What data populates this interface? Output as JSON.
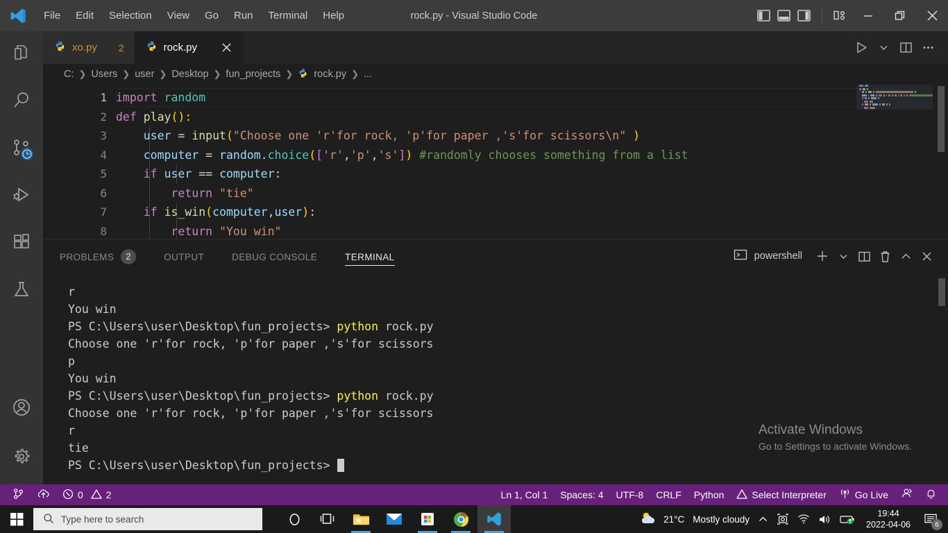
{
  "titlebar": {
    "menu": [
      "File",
      "Edit",
      "Selection",
      "View",
      "Go",
      "Run",
      "Terminal",
      "Help"
    ],
    "title": "rock.py - Visual Studio Code",
    "layout_controls": [
      "toggle-primary-sidebar",
      "toggle-panel",
      "toggle-secondary-sidebar",
      "customize-layout"
    ],
    "window_controls": [
      "minimize",
      "restore",
      "close"
    ]
  },
  "activitybar": {
    "items": [
      {
        "name": "explorer",
        "icon": "files-icon"
      },
      {
        "name": "search",
        "icon": "search-icon"
      },
      {
        "name": "source-control",
        "icon": "source-control-icon",
        "badge": "clock"
      },
      {
        "name": "run-and-debug",
        "icon": "debug-icon"
      },
      {
        "name": "extensions",
        "icon": "extensions-icon"
      },
      {
        "name": "testing",
        "icon": "beaker-icon"
      },
      {
        "name": "accounts",
        "icon": "account-icon"
      },
      {
        "name": "manage",
        "icon": "gear-icon"
      }
    ]
  },
  "tabs": [
    {
      "label": "xo.py",
      "icon": "python-icon",
      "badge": "2",
      "active": false,
      "dirty": true
    },
    {
      "label": "rock.py",
      "icon": "python-icon",
      "badge": "",
      "active": true,
      "dirty": false
    }
  ],
  "tab_actions": [
    "run-python-file",
    "run-dropdown",
    "split-editor",
    "more-actions"
  ],
  "breadcrumb": [
    "C:",
    "Users",
    "user",
    "Desktop",
    "fun_projects",
    "rock.py",
    "..."
  ],
  "breadcrumb_file_icon": "python-icon",
  "editor": {
    "language": "Python",
    "lines": [
      {
        "n": "1",
        "tokens": [
          {
            "t": "import ",
            "c": "k"
          },
          {
            "t": "random",
            "c": "mod"
          }
        ]
      },
      {
        "n": "2",
        "tokens": [
          {
            "t": "def ",
            "c": "k"
          },
          {
            "t": "play",
            "c": "fn"
          },
          {
            "t": "():",
            "c": "p1"
          }
        ]
      },
      {
        "n": "3",
        "tokens": [
          {
            "t": "    ",
            "c": "op"
          },
          {
            "t": "user",
            "c": "var"
          },
          {
            "t": " = ",
            "c": "op"
          },
          {
            "t": "input",
            "c": "fn"
          },
          {
            "t": "(",
            "c": "p1"
          },
          {
            "t": "\"Choose one 'r'for rock, 'p'for paper ,'s'for scissors\\n\"",
            "c": "str"
          },
          {
            "t": " )",
            "c": "p1"
          }
        ]
      },
      {
        "n": "4",
        "tokens": [
          {
            "t": "    ",
            "c": "op"
          },
          {
            "t": "computer",
            "c": "var"
          },
          {
            "t": " = ",
            "c": "op"
          },
          {
            "t": "random",
            "c": "var"
          },
          {
            "t": ".",
            "c": "op"
          },
          {
            "t": "choice",
            "c": "mod"
          },
          {
            "t": "(",
            "c": "p1"
          },
          {
            "t": "[",
            "c": "p2"
          },
          {
            "t": "'r'",
            "c": "str"
          },
          {
            "t": ",",
            "c": "op"
          },
          {
            "t": "'p'",
            "c": "str"
          },
          {
            "t": ",",
            "c": "op"
          },
          {
            "t": "'s'",
            "c": "str"
          },
          {
            "t": "]",
            "c": "p2"
          },
          {
            "t": ")",
            "c": "p1"
          },
          {
            "t": " #randomly chooses something from a list",
            "c": "cmt"
          }
        ]
      },
      {
        "n": "5",
        "tokens": [
          {
            "t": "    ",
            "c": "op"
          },
          {
            "t": "if ",
            "c": "k"
          },
          {
            "t": "user",
            "c": "var"
          },
          {
            "t": " == ",
            "c": "op"
          },
          {
            "t": "computer",
            "c": "var"
          },
          {
            "t": ":",
            "c": "op"
          }
        ]
      },
      {
        "n": "6",
        "tokens": [
          {
            "t": "        ",
            "c": "op"
          },
          {
            "t": "return ",
            "c": "k"
          },
          {
            "t": "\"tie\"",
            "c": "str"
          }
        ]
      },
      {
        "n": "7",
        "tokens": [
          {
            "t": "    ",
            "c": "op"
          },
          {
            "t": "if ",
            "c": "k"
          },
          {
            "t": "is_win",
            "c": "fn"
          },
          {
            "t": "(",
            "c": "p1"
          },
          {
            "t": "computer",
            "c": "var"
          },
          {
            "t": ",",
            "c": "op"
          },
          {
            "t": "user",
            "c": "var"
          },
          {
            "t": ")",
            "c": "p1"
          },
          {
            "t": ":",
            "c": "op"
          }
        ]
      },
      {
        "n": "8",
        "tokens": [
          {
            "t": "        ",
            "c": "op"
          },
          {
            "t": "return ",
            "c": "k"
          },
          {
            "t": "\"You win\"",
            "c": "str"
          }
        ]
      }
    ]
  },
  "panel": {
    "tabs": [
      {
        "label": "PROBLEMS",
        "badge": "2",
        "active": false
      },
      {
        "label": "OUTPUT",
        "badge": "",
        "active": false
      },
      {
        "label": "DEBUG CONSOLE",
        "badge": "",
        "active": false
      },
      {
        "label": "TERMINAL",
        "badge": "",
        "active": true
      }
    ],
    "shell": "powershell",
    "actions": [
      "new-terminal",
      "new-terminal-dropdown",
      "split-terminal",
      "kill-terminal",
      "maximize-panel",
      "close-panel"
    ],
    "terminal_lines": [
      [
        {
          "t": "r",
          "c": ""
        }
      ],
      [
        {
          "t": "You win",
          "c": ""
        }
      ],
      [
        {
          "t": "PS C:\\Users\\user\\Desktop\\fun_projects> ",
          "c": ""
        },
        {
          "t": "python",
          "c": "t-yellow"
        },
        {
          "t": " rock.py",
          "c": ""
        }
      ],
      [
        {
          "t": "Choose one 'r'for rock, 'p'for paper ,'s'for scissors",
          "c": ""
        }
      ],
      [
        {
          "t": "p",
          "c": ""
        }
      ],
      [
        {
          "t": "You win",
          "c": ""
        }
      ],
      [
        {
          "t": "PS C:\\Users\\user\\Desktop\\fun_projects> ",
          "c": ""
        },
        {
          "t": "python",
          "c": "t-yellow"
        },
        {
          "t": " rock.py",
          "c": ""
        }
      ],
      [
        {
          "t": "Choose one 'r'for rock, 'p'for paper ,'s'for scissors",
          "c": ""
        }
      ],
      [
        {
          "t": "r",
          "c": ""
        }
      ],
      [
        {
          "t": "tie",
          "c": ""
        }
      ],
      [
        {
          "t": "PS C:\\Users\\user\\Desktop\\fun_projects> ",
          "c": "",
          "cursor": true
        }
      ]
    ]
  },
  "watermark": {
    "title": "Activate Windows",
    "subtitle": "Go to Settings to activate Windows."
  },
  "statusbar": {
    "branch_icon": "source-control-icon",
    "sync_icon": "cloud-upload-icon",
    "errors": "0",
    "warnings": "2",
    "position": "Ln 1, Col 1",
    "indentation": "Spaces: 4",
    "encoding": "UTF-8",
    "eol": "CRLF",
    "language": "Python",
    "interpreter": "Select Interpreter",
    "golive": "Go Live",
    "accent": "#68217a"
  },
  "taskbar": {
    "search_placeholder": "Type here to search",
    "icons": [
      "cortana-icon",
      "task-view-icon",
      "file-explorer-icon",
      "mail-icon",
      "store-icon",
      "chrome-icon",
      "vscode-icon"
    ],
    "weather_temp": "21°C",
    "weather_desc": "Mostly cloudy",
    "time": "19:44",
    "date": "2022-04-06",
    "notification_count": "6"
  }
}
